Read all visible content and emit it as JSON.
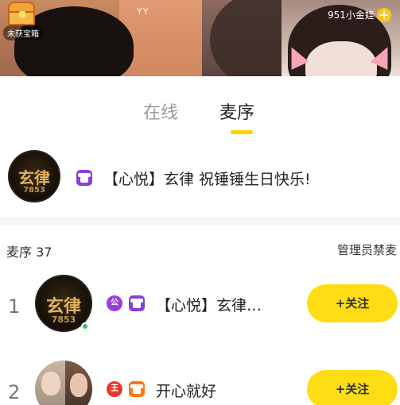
{
  "video": {
    "chest_label": "未获宝箱",
    "room_mark": "YY",
    "gold_text": "951小金娃",
    "gold_add": "+"
  },
  "tabs": [
    {
      "label": "在线",
      "active": false
    },
    {
      "label": "麦序",
      "active": true
    }
  ],
  "host": {
    "avatar_text": "玄律",
    "avatar_num": "7853",
    "message": "【心悦】玄律 祝锤锤生日快乐!"
  },
  "list": {
    "title": "麦序 37",
    "admin_action": "管理员禁麦",
    "rows": [
      {
        "index": "1",
        "avatar_text": "玄律",
        "avatar_num": "7853",
        "badge": "公",
        "name": "【心悦】玄律…",
        "follow": "+关注"
      },
      {
        "index": "2",
        "badge": "王",
        "name": "开心就好",
        "follow": "+关注"
      }
    ]
  },
  "colors": {
    "accent": "#ffdd14",
    "tab_underline": "#ffd200",
    "online": "#34c46b",
    "badge_purple": "#9a3fd6",
    "badge_red": "#e63a2d",
    "shirt_orange": "#f47b1f"
  }
}
